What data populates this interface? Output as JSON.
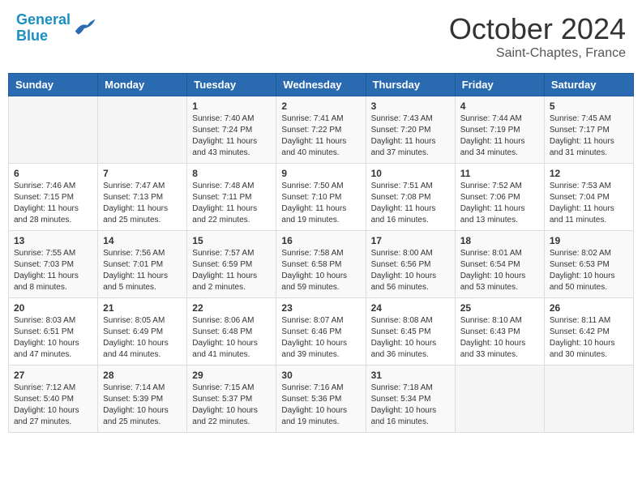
{
  "header": {
    "logo_line1": "General",
    "logo_line2": "Blue",
    "month": "October 2024",
    "location": "Saint-Chaptes, France"
  },
  "weekdays": [
    "Sunday",
    "Monday",
    "Tuesday",
    "Wednesday",
    "Thursday",
    "Friday",
    "Saturday"
  ],
  "weeks": [
    [
      {
        "day": "",
        "sunrise": "",
        "sunset": "",
        "daylight": ""
      },
      {
        "day": "",
        "sunrise": "",
        "sunset": "",
        "daylight": ""
      },
      {
        "day": "1",
        "sunrise": "Sunrise: 7:40 AM",
        "sunset": "Sunset: 7:24 PM",
        "daylight": "Daylight: 11 hours and 43 minutes."
      },
      {
        "day": "2",
        "sunrise": "Sunrise: 7:41 AM",
        "sunset": "Sunset: 7:22 PM",
        "daylight": "Daylight: 11 hours and 40 minutes."
      },
      {
        "day": "3",
        "sunrise": "Sunrise: 7:43 AM",
        "sunset": "Sunset: 7:20 PM",
        "daylight": "Daylight: 11 hours and 37 minutes."
      },
      {
        "day": "4",
        "sunrise": "Sunrise: 7:44 AM",
        "sunset": "Sunset: 7:19 PM",
        "daylight": "Daylight: 11 hours and 34 minutes."
      },
      {
        "day": "5",
        "sunrise": "Sunrise: 7:45 AM",
        "sunset": "Sunset: 7:17 PM",
        "daylight": "Daylight: 11 hours and 31 minutes."
      }
    ],
    [
      {
        "day": "6",
        "sunrise": "Sunrise: 7:46 AM",
        "sunset": "Sunset: 7:15 PM",
        "daylight": "Daylight: 11 hours and 28 minutes."
      },
      {
        "day": "7",
        "sunrise": "Sunrise: 7:47 AM",
        "sunset": "Sunset: 7:13 PM",
        "daylight": "Daylight: 11 hours and 25 minutes."
      },
      {
        "day": "8",
        "sunrise": "Sunrise: 7:48 AM",
        "sunset": "Sunset: 7:11 PM",
        "daylight": "Daylight: 11 hours and 22 minutes."
      },
      {
        "day": "9",
        "sunrise": "Sunrise: 7:50 AM",
        "sunset": "Sunset: 7:10 PM",
        "daylight": "Daylight: 11 hours and 19 minutes."
      },
      {
        "day": "10",
        "sunrise": "Sunrise: 7:51 AM",
        "sunset": "Sunset: 7:08 PM",
        "daylight": "Daylight: 11 hours and 16 minutes."
      },
      {
        "day": "11",
        "sunrise": "Sunrise: 7:52 AM",
        "sunset": "Sunset: 7:06 PM",
        "daylight": "Daylight: 11 hours and 13 minutes."
      },
      {
        "day": "12",
        "sunrise": "Sunrise: 7:53 AM",
        "sunset": "Sunset: 7:04 PM",
        "daylight": "Daylight: 11 hours and 11 minutes."
      }
    ],
    [
      {
        "day": "13",
        "sunrise": "Sunrise: 7:55 AM",
        "sunset": "Sunset: 7:03 PM",
        "daylight": "Daylight: 11 hours and 8 minutes."
      },
      {
        "day": "14",
        "sunrise": "Sunrise: 7:56 AM",
        "sunset": "Sunset: 7:01 PM",
        "daylight": "Daylight: 11 hours and 5 minutes."
      },
      {
        "day": "15",
        "sunrise": "Sunrise: 7:57 AM",
        "sunset": "Sunset: 6:59 PM",
        "daylight": "Daylight: 11 hours and 2 minutes."
      },
      {
        "day": "16",
        "sunrise": "Sunrise: 7:58 AM",
        "sunset": "Sunset: 6:58 PM",
        "daylight": "Daylight: 10 hours and 59 minutes."
      },
      {
        "day": "17",
        "sunrise": "Sunrise: 8:00 AM",
        "sunset": "Sunset: 6:56 PM",
        "daylight": "Daylight: 10 hours and 56 minutes."
      },
      {
        "day": "18",
        "sunrise": "Sunrise: 8:01 AM",
        "sunset": "Sunset: 6:54 PM",
        "daylight": "Daylight: 10 hours and 53 minutes."
      },
      {
        "day": "19",
        "sunrise": "Sunrise: 8:02 AM",
        "sunset": "Sunset: 6:53 PM",
        "daylight": "Daylight: 10 hours and 50 minutes."
      }
    ],
    [
      {
        "day": "20",
        "sunrise": "Sunrise: 8:03 AM",
        "sunset": "Sunset: 6:51 PM",
        "daylight": "Daylight: 10 hours and 47 minutes."
      },
      {
        "day": "21",
        "sunrise": "Sunrise: 8:05 AM",
        "sunset": "Sunset: 6:49 PM",
        "daylight": "Daylight: 10 hours and 44 minutes."
      },
      {
        "day": "22",
        "sunrise": "Sunrise: 8:06 AM",
        "sunset": "Sunset: 6:48 PM",
        "daylight": "Daylight: 10 hours and 41 minutes."
      },
      {
        "day": "23",
        "sunrise": "Sunrise: 8:07 AM",
        "sunset": "Sunset: 6:46 PM",
        "daylight": "Daylight: 10 hours and 39 minutes."
      },
      {
        "day": "24",
        "sunrise": "Sunrise: 8:08 AM",
        "sunset": "Sunset: 6:45 PM",
        "daylight": "Daylight: 10 hours and 36 minutes."
      },
      {
        "day": "25",
        "sunrise": "Sunrise: 8:10 AM",
        "sunset": "Sunset: 6:43 PM",
        "daylight": "Daylight: 10 hours and 33 minutes."
      },
      {
        "day": "26",
        "sunrise": "Sunrise: 8:11 AM",
        "sunset": "Sunset: 6:42 PM",
        "daylight": "Daylight: 10 hours and 30 minutes."
      }
    ],
    [
      {
        "day": "27",
        "sunrise": "Sunrise: 7:12 AM",
        "sunset": "Sunset: 5:40 PM",
        "daylight": "Daylight: 10 hours and 27 minutes."
      },
      {
        "day": "28",
        "sunrise": "Sunrise: 7:14 AM",
        "sunset": "Sunset: 5:39 PM",
        "daylight": "Daylight: 10 hours and 25 minutes."
      },
      {
        "day": "29",
        "sunrise": "Sunrise: 7:15 AM",
        "sunset": "Sunset: 5:37 PM",
        "daylight": "Daylight: 10 hours and 22 minutes."
      },
      {
        "day": "30",
        "sunrise": "Sunrise: 7:16 AM",
        "sunset": "Sunset: 5:36 PM",
        "daylight": "Daylight: 10 hours and 19 minutes."
      },
      {
        "day": "31",
        "sunrise": "Sunrise: 7:18 AM",
        "sunset": "Sunset: 5:34 PM",
        "daylight": "Daylight: 10 hours and 16 minutes."
      },
      {
        "day": "",
        "sunrise": "",
        "sunset": "",
        "daylight": ""
      },
      {
        "day": "",
        "sunrise": "",
        "sunset": "",
        "daylight": ""
      }
    ]
  ]
}
